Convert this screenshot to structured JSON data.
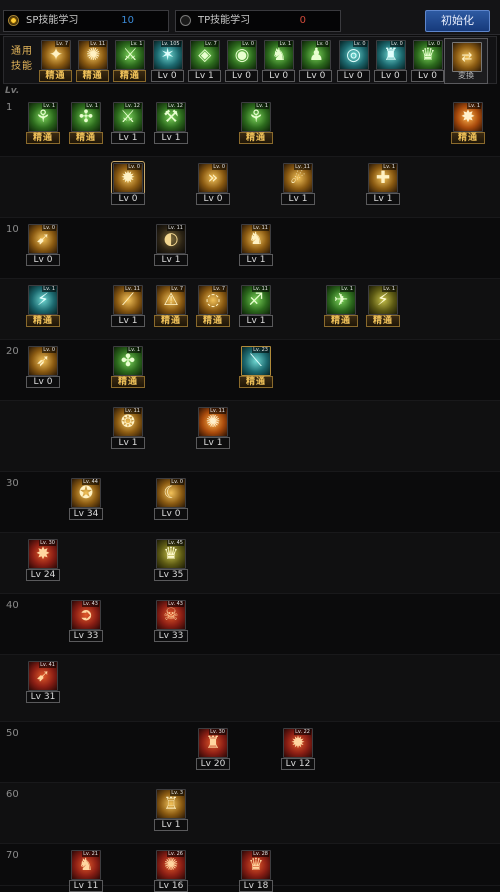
{
  "tabs": {
    "sp": {
      "label": "SP技能学习",
      "count": "10",
      "count_color": "#3b8bd8"
    },
    "tp": {
      "label": "TP技能学习",
      "count": "0",
      "count_color": "#d04a3a"
    }
  },
  "init_button": "初始化",
  "common": {
    "label": "通用技能",
    "swap_label": "変換",
    "items": [
      {
        "lv": "Lv. 7",
        "glyph": "✦",
        "tone": "t-gold",
        "badge": "精通",
        "jt": true
      },
      {
        "lv": "Lv. 11",
        "glyph": "✺",
        "tone": "t-gold",
        "badge": "精通",
        "jt": true
      },
      {
        "lv": "Lv. 1",
        "glyph": "⚔",
        "tone": "t-green",
        "badge": "精通",
        "jt": true
      },
      {
        "lv": "Lv. 105",
        "glyph": "✶",
        "tone": "t-teal",
        "badge": "Lv 0",
        "jt": false
      },
      {
        "lv": "Lv. 7",
        "glyph": "◈",
        "tone": "t-green",
        "badge": "Lv 1",
        "jt": false
      },
      {
        "lv": "Lv. 0",
        "glyph": "◉",
        "tone": "t-green",
        "badge": "Lv 0",
        "jt": false
      },
      {
        "lv": "Lv. 1",
        "glyph": "♞",
        "tone": "t-green",
        "badge": "Lv 0",
        "jt": false
      },
      {
        "lv": "Lv. 0",
        "glyph": "♟",
        "tone": "t-green",
        "badge": "Lv 0",
        "jt": false
      },
      {
        "lv": "Lv. 0",
        "glyph": "◎",
        "tone": "t-teal",
        "badge": "Lv 0",
        "jt": false
      },
      {
        "lv": "Lv. 0",
        "glyph": "♜",
        "tone": "t-teal",
        "badge": "Lv 0",
        "jt": false
      },
      {
        "lv": "Lv. 0",
        "glyph": "♛",
        "tone": "t-green",
        "badge": "Lv 0",
        "jt": false
      }
    ]
  },
  "level_header": "Lv.",
  "row_levels": [
    "1",
    "",
    "10",
    "",
    "20",
    "",
    "30",
    "",
    "40",
    "",
    "50",
    "60",
    "70"
  ],
  "skills": [
    {
      "row": 0,
      "col": 0,
      "lv": "Lv. 1",
      "glyph": "⚘",
      "tone": "t-green",
      "badge": "精通",
      "jt": true
    },
    {
      "row": 0,
      "col": 1,
      "lv": "Lv. 1",
      "glyph": "✣",
      "tone": "t-green",
      "badge": "精通",
      "jt": true
    },
    {
      "row": 0,
      "col": 2,
      "lv": "Lv. 12",
      "glyph": "⚔",
      "tone": "t-green",
      "badge": "Lv 1",
      "jt": false
    },
    {
      "row": 0,
      "col": 3,
      "lv": "Lv. 12",
      "glyph": "⚒",
      "tone": "t-green",
      "badge": "Lv 1",
      "jt": false
    },
    {
      "row": 0,
      "col": 5,
      "lv": "Lv. 1",
      "glyph": "⚘",
      "tone": "t-green",
      "badge": "精通",
      "jt": true
    },
    {
      "row": 0,
      "col": 10,
      "lv": "Lv. 1",
      "glyph": "✸",
      "tone": "t-orange",
      "badge": "精通",
      "jt": true
    },
    {
      "row": 1,
      "col": 2,
      "lv": "Lv. 0",
      "glyph": "✹",
      "tone": "t-gold",
      "badge": "Lv 0",
      "jt": false,
      "sel": true
    },
    {
      "row": 1,
      "col": 4,
      "lv": "Lv. 0",
      "glyph": "»",
      "tone": "t-gold",
      "badge": "Lv 0",
      "jt": false
    },
    {
      "row": 1,
      "col": 6,
      "lv": "Lv. 11",
      "glyph": "☄",
      "tone": "t-gold",
      "badge": "Lv 1",
      "jt": false
    },
    {
      "row": 1,
      "col": 8,
      "lv": "Lv. 1",
      "glyph": "✚",
      "tone": "t-gold",
      "badge": "Lv 1",
      "jt": false
    },
    {
      "row": 2,
      "col": 0,
      "lv": "Lv. 0",
      "glyph": "➹",
      "tone": "t-gold",
      "badge": "Lv 0",
      "jt": false
    },
    {
      "row": 2,
      "col": 3,
      "lv": "Lv. 11",
      "glyph": "◐",
      "tone": "t-dark",
      "badge": "Lv 1",
      "jt": false
    },
    {
      "row": 2,
      "col": 5,
      "lv": "Lv. 11",
      "glyph": "♞",
      "tone": "t-gold",
      "badge": "Lv 1",
      "jt": false
    },
    {
      "row": 3,
      "col": 0,
      "lv": "Lv. 1",
      "glyph": "⚡",
      "tone": "t-teal",
      "badge": "精通",
      "jt": true
    },
    {
      "row": 3,
      "col": 2,
      "lv": "Lv. 11",
      "glyph": "⟋",
      "tone": "t-gold",
      "badge": "Lv 1",
      "jt": false
    },
    {
      "row": 3,
      "col": 3,
      "lv": "Lv. 7",
      "glyph": "⚠",
      "tone": "t-gold",
      "badge": "精通",
      "jt": true
    },
    {
      "row": 3,
      "col": 4,
      "lv": "Lv. 7",
      "glyph": "◌",
      "tone": "t-gold",
      "badge": "精通",
      "jt": true
    },
    {
      "row": 3,
      "col": 5,
      "lv": "Lv. 11",
      "glyph": "♐",
      "tone": "t-green",
      "badge": "Lv 1",
      "jt": false
    },
    {
      "row": 3,
      "col": 7,
      "lv": "Lv. 1",
      "glyph": "✈",
      "tone": "t-green",
      "badge": "精通",
      "jt": true
    },
    {
      "row": 3,
      "col": 8,
      "lv": "Lv. 1",
      "glyph": "⚡",
      "tone": "t-olive",
      "badge": "精通",
      "jt": true
    },
    {
      "row": 4,
      "col": 0,
      "lv": "Lv. 0",
      "glyph": "➶",
      "tone": "t-gold",
      "badge": "Lv 0",
      "jt": false
    },
    {
      "row": 4,
      "col": 2,
      "lv": "Lv. 1",
      "glyph": "✤",
      "tone": "t-green",
      "badge": "精通",
      "jt": true
    },
    {
      "row": 4,
      "col": 5,
      "lv": "Lv. 23",
      "glyph": "⟍",
      "tone": "t-teal",
      "badge": "精通",
      "jt": true,
      "gold": true
    },
    {
      "row": 5,
      "col": 2,
      "lv": "Lv. 11",
      "glyph": "❂",
      "tone": "t-gold",
      "badge": "Lv 1",
      "jt": false
    },
    {
      "row": 5,
      "col": 4,
      "lv": "Lv. 11",
      "glyph": "✺",
      "tone": "t-orange",
      "badge": "Lv 1",
      "jt": false
    },
    {
      "row": 6,
      "col": 1,
      "lv": "Lv. 44",
      "glyph": "✪",
      "tone": "t-gold",
      "badge": "Lv 34",
      "jt": false
    },
    {
      "row": 6,
      "col": 3,
      "lv": "Lv. 0",
      "glyph": "☾",
      "tone": "t-gold",
      "badge": "Lv 0",
      "jt": false
    },
    {
      "row": 7,
      "col": 0,
      "lv": "Lv. 30",
      "glyph": "✸",
      "tone": "t-red",
      "badge": "Lv 24",
      "jt": false
    },
    {
      "row": 7,
      "col": 3,
      "lv": "Lv. 45",
      "glyph": "♛",
      "tone": "t-olive",
      "badge": "Lv 35",
      "jt": false
    },
    {
      "row": 8,
      "col": 1,
      "lv": "Lv. 43",
      "glyph": "➲",
      "tone": "t-red",
      "badge": "Lv 33",
      "jt": false
    },
    {
      "row": 8,
      "col": 3,
      "lv": "Lv. 43",
      "glyph": "☠",
      "tone": "t-red",
      "badge": "Lv 33",
      "jt": false
    },
    {
      "row": 9,
      "col": 0,
      "lv": "Lv. 41",
      "glyph": "➹",
      "tone": "t-red",
      "badge": "Lv 31",
      "jt": false
    },
    {
      "row": 10,
      "col": 4,
      "lv": "Lv. 30",
      "glyph": "♜",
      "tone": "t-red",
      "badge": "Lv 20",
      "jt": false
    },
    {
      "row": 10,
      "col": 6,
      "lv": "Lv. 22",
      "glyph": "✹",
      "tone": "t-red",
      "badge": "Lv 12",
      "jt": false
    },
    {
      "row": 11,
      "col": 3,
      "lv": "Lv. 3",
      "glyph": "♖",
      "tone": "t-gold",
      "badge": "Lv 1",
      "jt": false
    },
    {
      "row": 12,
      "col": 1,
      "lv": "Lv. 21",
      "glyph": "♞",
      "tone": "t-red",
      "badge": "Lv 11",
      "jt": false
    },
    {
      "row": 12,
      "col": 3,
      "lv": "Lv. 26",
      "glyph": "✺",
      "tone": "t-red",
      "badge": "Lv 16",
      "jt": false
    },
    {
      "row": 12,
      "col": 5,
      "lv": "Lv. 28",
      "glyph": "♛",
      "tone": "t-red",
      "badge": "Lv 18",
      "jt": false
    }
  ]
}
